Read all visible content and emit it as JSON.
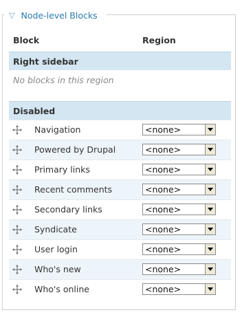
{
  "fieldset": {
    "legend": "Node-level Blocks"
  },
  "table": {
    "headers": {
      "block": "Block",
      "region": "Region"
    },
    "regions": [
      {
        "title": "Right sidebar",
        "empty_message": "No blocks in this region"
      },
      {
        "title": "Disabled"
      }
    ],
    "rows": [
      {
        "name": "Navigation",
        "region": "<none>"
      },
      {
        "name": "Powered by Drupal",
        "region": "<none>"
      },
      {
        "name": "Primary links",
        "region": "<none>"
      },
      {
        "name": "Recent comments",
        "region": "<none>"
      },
      {
        "name": "Secondary links",
        "region": "<none>"
      },
      {
        "name": "Syndicate",
        "region": "<none>"
      },
      {
        "name": "User login",
        "region": "<none>"
      },
      {
        "name": "Who's new",
        "region": "<none>"
      },
      {
        "name": "Who's online",
        "region": "<none>"
      }
    ]
  },
  "colors": {
    "legend_link": "#2a7aaf",
    "region_header_bg": "#d3e6f2",
    "even_row_bg": "#edf5fa"
  }
}
